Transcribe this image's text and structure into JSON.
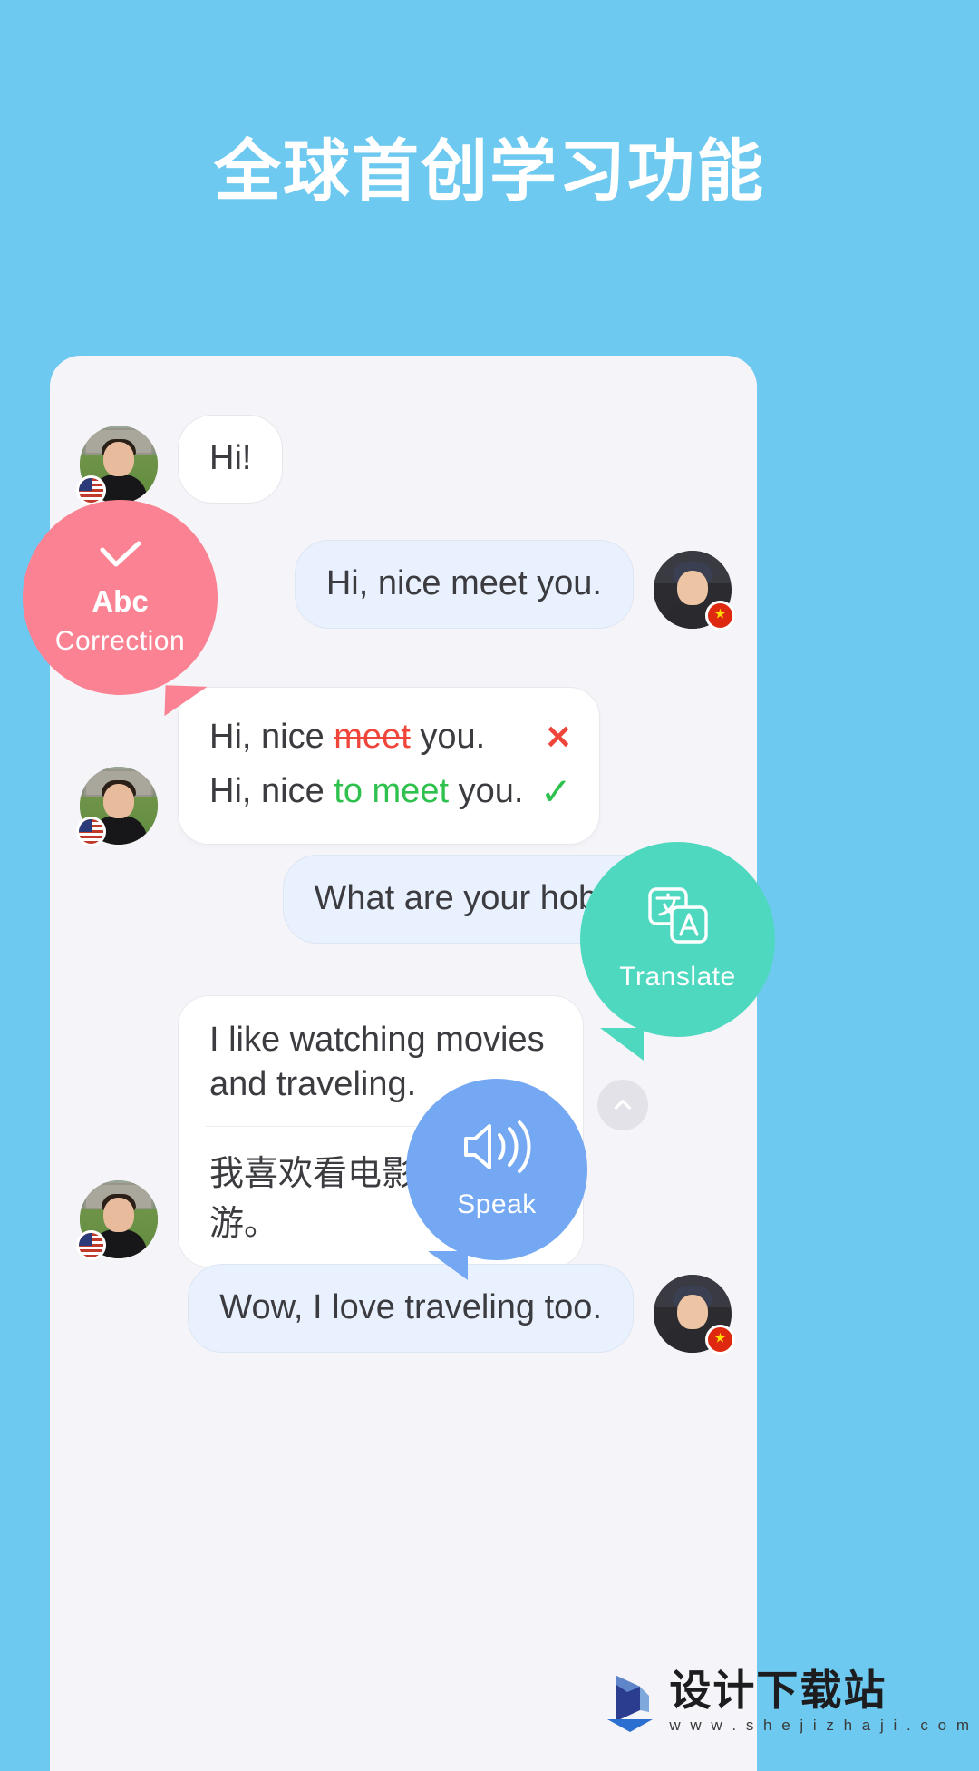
{
  "header": {
    "title": "全球首创学习功能"
  },
  "chat": {
    "messages": [
      {
        "id": "msg-hi",
        "side": "left",
        "type": "text",
        "text": "Hi!",
        "flag": "us"
      },
      {
        "id": "msg-nice-meet",
        "side": "right",
        "type": "text",
        "text": "Hi, nice meet you.",
        "flag": "cn"
      },
      {
        "id": "msg-correction",
        "side": "left",
        "type": "correction",
        "wrong_prefix": "Hi, nice ",
        "wrong_word": "meet",
        "wrong_suffix": " you.",
        "wrong_mark": "✕",
        "right_prefix": "Hi, nice ",
        "right_word": "to meet",
        "right_suffix": " you.",
        "right_mark": "✓",
        "flag": "us"
      },
      {
        "id": "msg-hobbies",
        "side": "right",
        "type": "text",
        "text": "What are your hobbies?",
        "flag": "cn"
      },
      {
        "id": "msg-translate",
        "side": "left",
        "type": "translation",
        "text_en": "I like watching movies and traveling.",
        "text_zh": "我喜欢看电影和旅游。",
        "flag": "us"
      },
      {
        "id": "msg-wow",
        "side": "right",
        "type": "text",
        "text": "Wow, I love traveling too.",
        "flag": "cn"
      }
    ]
  },
  "badges": {
    "correction": {
      "icon": "check-icon",
      "abc": "Abc",
      "label": "Correction",
      "color": "#fa8293"
    },
    "translate": {
      "icon": "translate-icon",
      "label": "Translate",
      "color": "#4ed8bf"
    },
    "speak": {
      "icon": "speaker-icon",
      "label": "Speak",
      "color": "#74a8f2"
    }
  },
  "controls": {
    "scroll_up_icon": "chevron-up-icon"
  },
  "watermark": {
    "name": "设计下载站",
    "url": "w w w . s h e j i z h a j i . c o m"
  },
  "colors": {
    "background": "#6ec9f0",
    "panel": "#f5f4f8",
    "bubble_blue": "#e8f1fd",
    "bubble_white": "#ffffff",
    "error": "#f0453a",
    "success": "#2ec14e"
  }
}
